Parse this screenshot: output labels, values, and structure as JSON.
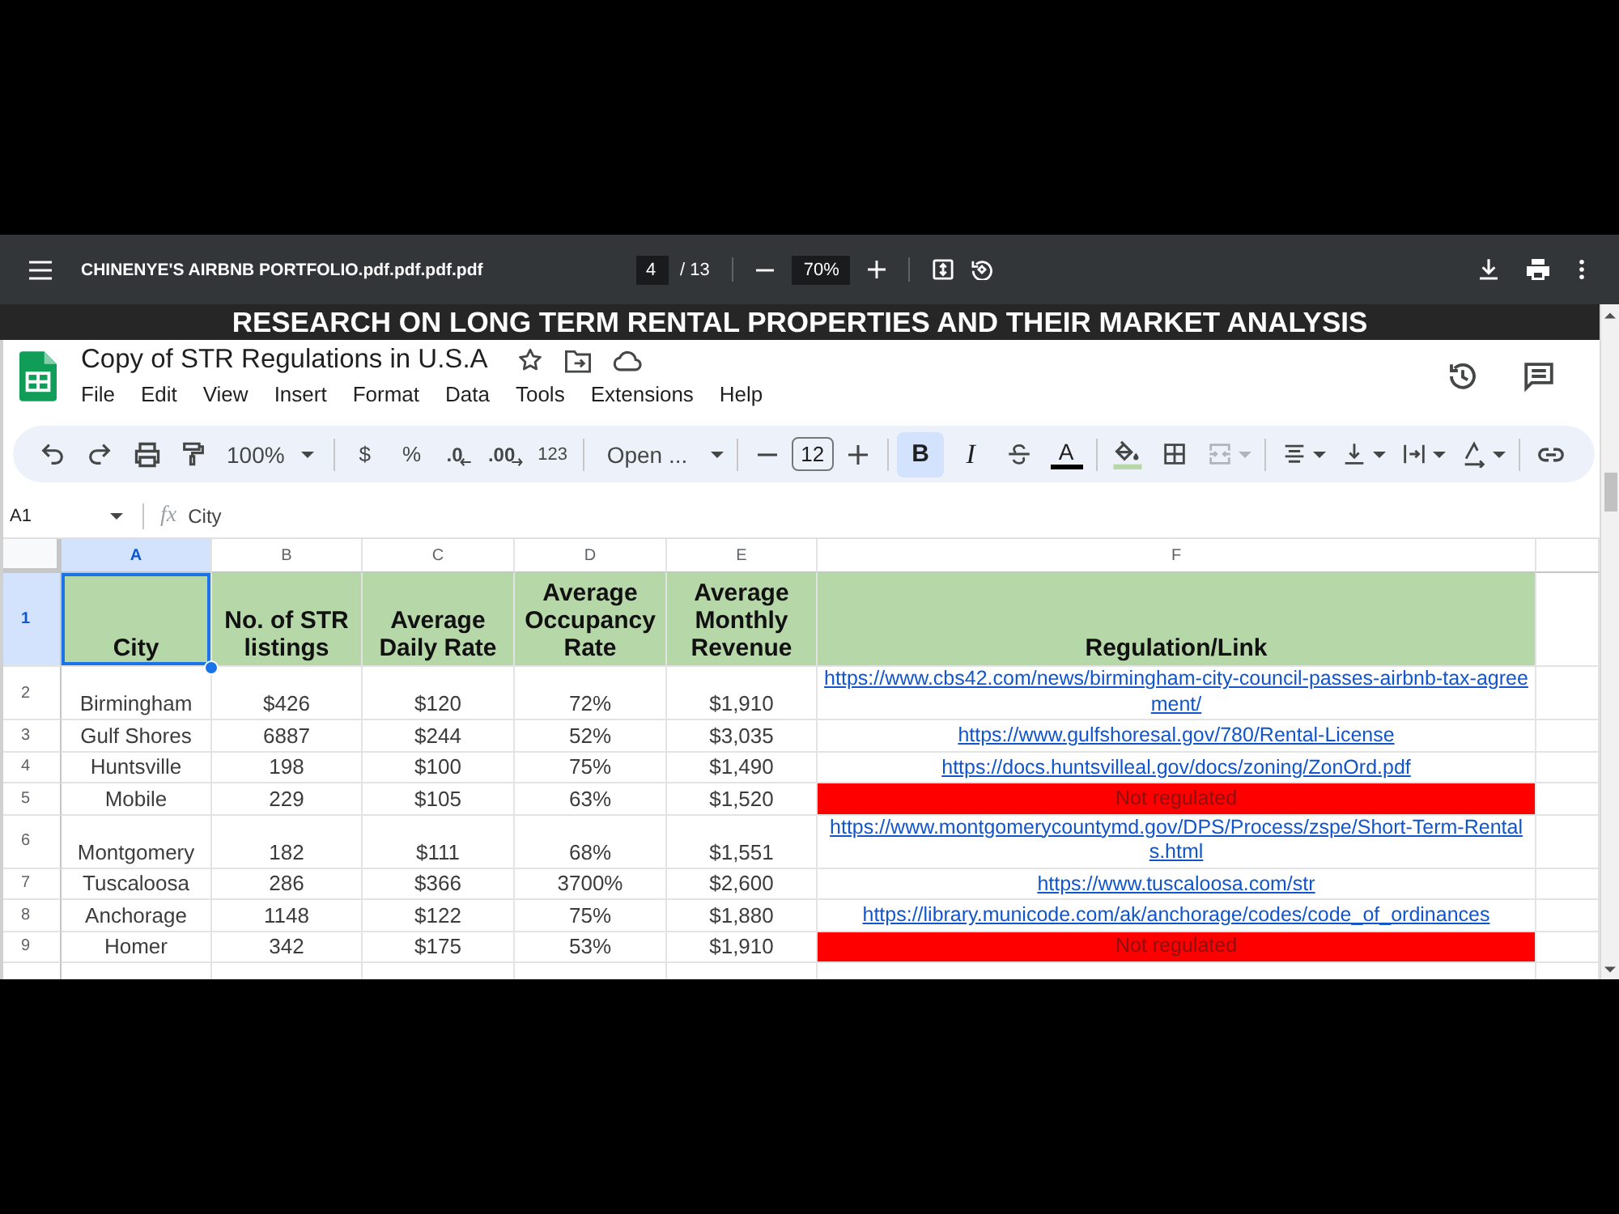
{
  "pdf_viewer": {
    "title": "CHINENYE'S AIRBNB PORTFOLIO.pdf.pdf.pdf.pdf",
    "page": "4",
    "page_total": "/ 13",
    "zoom": "70%"
  },
  "document_heading": "RESEARCH ON LONG TERM RENTAL PROPERTIES AND THEIR MARKET ANALYSIS",
  "spreadsheet": {
    "title": "Copy of STR Regulations in U.S.A",
    "menu": [
      "File",
      "Edit",
      "View",
      "Insert",
      "Format",
      "Data",
      "Tools",
      "Extensions",
      "Help"
    ],
    "toolbar": {
      "zoom": "100%",
      "currency": "$",
      "percent": "%",
      "decrease_decimal": ".0",
      "increase_decimal": ".00",
      "number_format": "123",
      "font": "Open ...",
      "font_size": "12",
      "bold": {
        "label": "B",
        "on": true
      },
      "italic": {
        "label": "I",
        "on": false
      },
      "text_color": "A",
      "merge_cells": {
        "disabled": true
      }
    },
    "name_box": "A1",
    "formula_label": "fx",
    "formula": "City",
    "columns": [
      {
        "label": "A",
        "selected": true
      },
      {
        "label": "B",
        "selected": false
      },
      {
        "label": "C",
        "selected": false
      },
      {
        "label": "D",
        "selected": false
      },
      {
        "label": "E",
        "selected": false
      },
      {
        "label": "F",
        "selected": false
      }
    ],
    "rows": [
      {
        "number": "1",
        "selected": true,
        "kind": "header",
        "cells": [
          "City",
          "No. of STR listings",
          "Average Daily Rate",
          "Average Occupancy Rate",
          "Average Monthly Revenue"
        ],
        "regulation": {
          "kind": "text",
          "text": "Regulation/Link"
        }
      },
      {
        "number": "2",
        "selected": false,
        "kind": "data",
        "cells": [
          "Birmingham",
          "$426",
          "$120",
          "72%",
          "$1,910"
        ],
        "regulation": {
          "kind": "link",
          "text": "https://www.cbs42.com/news/birmingham-city-council-passes-airbnb-tax-agreement/"
        }
      },
      {
        "number": "3",
        "selected": false,
        "kind": "data",
        "cells": [
          "Gulf Shores",
          "6887",
          "$244",
          "52%",
          "$3,035"
        ],
        "regulation": {
          "kind": "link",
          "text": "https://www.gulfshoresal.gov/780/Rental-License"
        }
      },
      {
        "number": "4",
        "selected": false,
        "kind": "data",
        "cells": [
          "Huntsville",
          "198",
          "$100",
          "75%",
          "$1,490"
        ],
        "regulation": {
          "kind": "link",
          "text": "https://docs.huntsvilleal.gov/docs/zoning/ZonOrd.pdf"
        }
      },
      {
        "number": "5",
        "selected": false,
        "kind": "data",
        "cells": [
          "Mobile",
          "229",
          "$105",
          "63%",
          "$1,520"
        ],
        "regulation": {
          "kind": "flag",
          "text": "Not regulated",
          "color": "#ff0000"
        }
      },
      {
        "number": "6",
        "selected": false,
        "kind": "data",
        "cells": [
          "Montgomery",
          "182",
          "$111",
          "68%",
          "$1,551"
        ],
        "regulation": {
          "kind": "link",
          "text": "https://www.montgomerycountymd.gov/DPS/Process/zspe/Short-Term-Rentals.html"
        }
      },
      {
        "number": "7",
        "selected": false,
        "kind": "data",
        "cells": [
          "Tuscaloosa",
          "286",
          "$366",
          "3700%",
          "$2,600"
        ],
        "regulation": {
          "kind": "link",
          "text": "https://www.tuscaloosa.com/str"
        }
      },
      {
        "number": "8",
        "selected": false,
        "kind": "data",
        "cells": [
          "Anchorage",
          "1148",
          "$122",
          "75%",
          "$1,880"
        ],
        "regulation": {
          "kind": "link",
          "text": "https://library.municode.com/ak/anchorage/codes/code_of_ordinances"
        }
      },
      {
        "number": "9",
        "selected": false,
        "kind": "data",
        "cells": [
          "Homer",
          "342",
          "$175",
          "53%",
          "$1,910"
        ],
        "regulation": {
          "kind": "flag",
          "text": "Not regulated",
          "color": "#ff0000"
        }
      }
    ]
  }
}
